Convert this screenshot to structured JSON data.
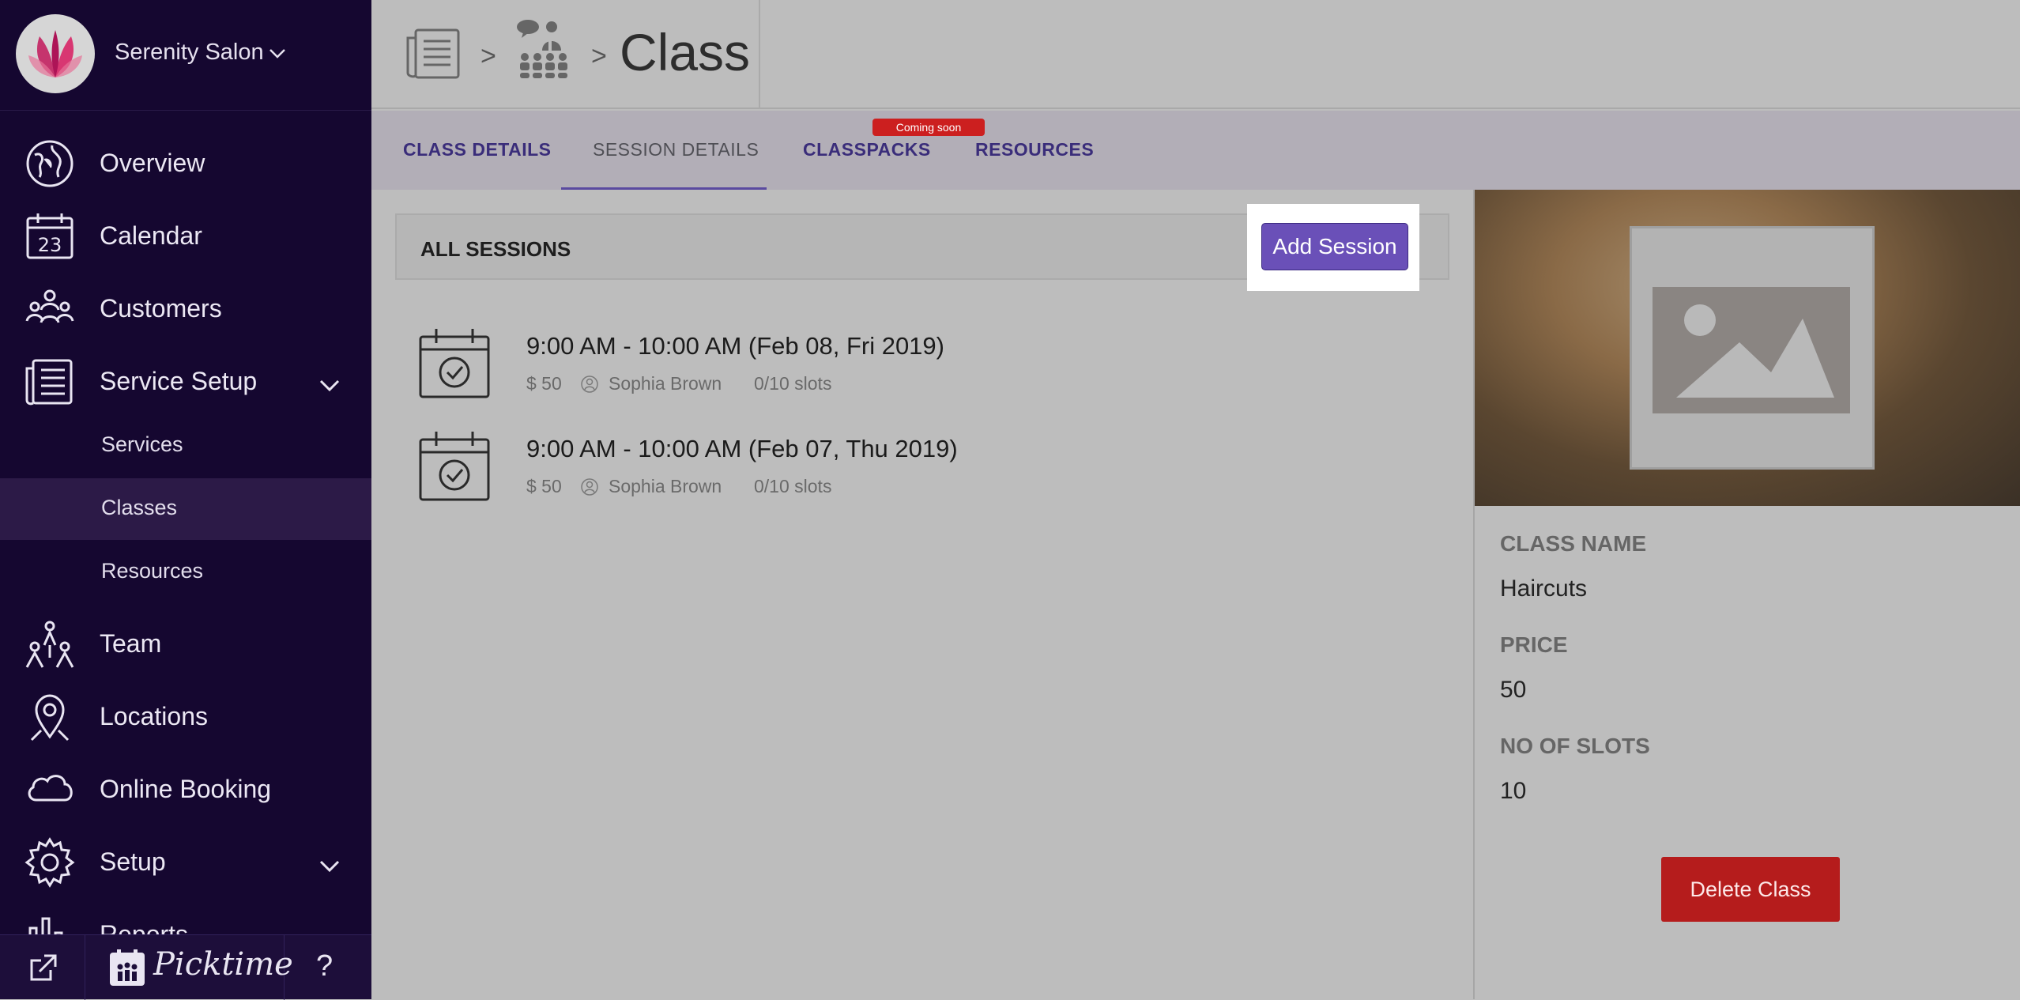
{
  "brand": {
    "name": "Serenity Salon"
  },
  "sidebar": {
    "items": [
      {
        "label": "Overview"
      },
      {
        "label": "Calendar"
      },
      {
        "label": "Customers"
      },
      {
        "label": "Service Setup"
      },
      {
        "label": "Team"
      },
      {
        "label": "Locations"
      },
      {
        "label": "Online Booking"
      },
      {
        "label": "Setup"
      },
      {
        "label": "Reports"
      }
    ],
    "calendar_day": "23",
    "sub_items": [
      {
        "label": "Services"
      },
      {
        "label": "Classes"
      },
      {
        "label": "Resources"
      }
    ],
    "footer": {
      "brand_text": "Picktime",
      "help": "?"
    }
  },
  "header": {
    "separator": ">",
    "title": "Class"
  },
  "tabs": [
    {
      "label": "CLASS DETAILS"
    },
    {
      "label": "SESSION DETAILS"
    },
    {
      "label": "CLASSPACKS"
    },
    {
      "label": "RESOURCES"
    }
  ],
  "badge": {
    "coming_soon": "Coming soon"
  },
  "sessions": {
    "title": "ALL SESSIONS",
    "add_button": "Add Session",
    "list": [
      {
        "time": "9:00 AM - 10:00 AM (Feb 08, Fri 2019)",
        "price": "$ 50",
        "staff": "Sophia Brown",
        "slots": "0/10 slots"
      },
      {
        "time": "9:00 AM - 10:00 AM (Feb 07, Thu 2019)",
        "price": "$ 50",
        "staff": "Sophia Brown",
        "slots": "0/10 slots"
      }
    ]
  },
  "class_info": {
    "name_label": "CLASS NAME",
    "name_value": "Haircuts",
    "price_label": "PRICE",
    "price_value": "50",
    "slots_label": "NO OF SLOTS",
    "slots_value": "10",
    "delete_button": "Delete Class"
  },
  "colors": {
    "sidebar_bg": "#150730",
    "accent": "#6a50b8",
    "danger": "#b51c1c"
  }
}
